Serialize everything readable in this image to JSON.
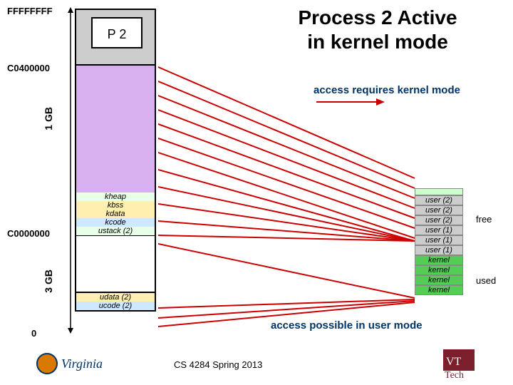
{
  "title_line1": "Process 2 Active",
  "title_line2": "in kernel mode",
  "addresses": {
    "top": "FFFFFFFF",
    "k_top": "C0400000",
    "k_base": "C0000000",
    "zero": "0"
  },
  "process_box": "P 2",
  "gb_labels": {
    "one": "1 GB",
    "three": "3 GB"
  },
  "kernel_segments": [
    "kheap",
    "kbss",
    "kdata",
    "kcode",
    "ustack (2)"
  ],
  "user_segments": [
    "udata (2)",
    "ucode (2)"
  ],
  "access_kernel": "access requires kernel mode",
  "access_user": "access possible in user mode",
  "phys_frames": [
    "user (2)",
    "user (2)",
    "user (2)",
    "user (1)",
    "user (1)",
    "user (1)",
    "kernel",
    "kernel",
    "kernel",
    "kernel"
  ],
  "phys_labels": {
    "free": "free",
    "used": "used"
  },
  "footer": "CS 4284 Spring 2013"
}
